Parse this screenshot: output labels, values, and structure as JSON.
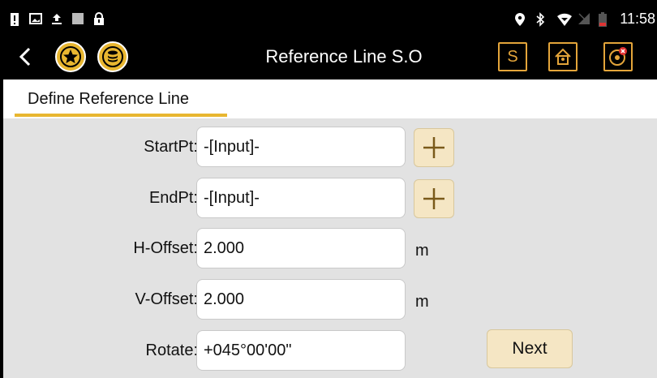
{
  "status_bar": {
    "time": "11:58",
    "icons_left": [
      "alert-icon",
      "image-icon",
      "upload-icon",
      "square-icon",
      "lock-icon"
    ],
    "icons_right": [
      "location-icon",
      "bluetooth-icon",
      "wifi-icon",
      "no-sim-icon",
      "battery-low-icon"
    ]
  },
  "app_bar": {
    "title": "Reference Line S.O",
    "s_button_label": "S"
  },
  "tabs": [
    {
      "label": "Define Reference Line",
      "active": true
    }
  ],
  "form": {
    "rows": [
      {
        "label": "StartPt:",
        "value": "-[Input]-"
      },
      {
        "label": "EndPt:",
        "value": "-[Input]-"
      },
      {
        "label": "H-Offset:",
        "value": "2.000",
        "unit": "m"
      },
      {
        "label": "V-Offset:",
        "value": "2.000",
        "unit": "m"
      },
      {
        "label": "Rotate:",
        "value": "+045°00'00\""
      }
    ],
    "next_label": "Next"
  },
  "colors": {
    "accent": "#e8b630",
    "button_bg": "#f5e6c4",
    "panel_bg": "#e2e2e2",
    "outline_orange": "#e4a53a"
  }
}
